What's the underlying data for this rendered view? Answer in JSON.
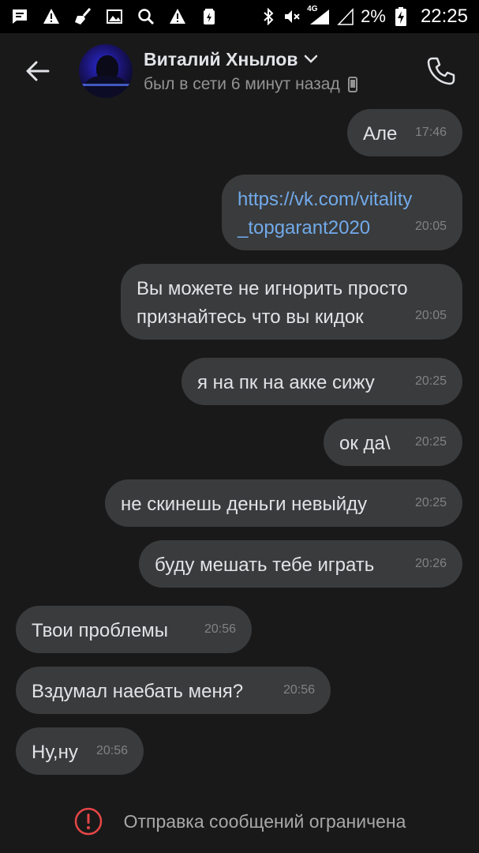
{
  "status_bar": {
    "battery_percent": "2%",
    "time": "22:25",
    "network": "4G",
    "left_icons": [
      "message-icon",
      "warning-icon",
      "broom-icon",
      "image-icon",
      "search-icon",
      "warning-icon",
      "battery-icon"
    ],
    "right_icons": [
      "bluetooth-icon",
      "mute-icon",
      "signal-icon",
      "battery-charging-icon"
    ]
  },
  "header": {
    "name": "Виталий Хнылов",
    "status": "был в сети 6 минут назад"
  },
  "messages": [
    {
      "dir": "out",
      "text": "Але",
      "time": "17:46"
    },
    {
      "dir": "out",
      "text": "https://vk.com/vitality_topgarant2020",
      "line1": "https://vk.com/vitality",
      "line2": "_topgarant2020",
      "time": "20:05"
    },
    {
      "dir": "out",
      "text": "Вы можете не игнорить просто признайтесь что вы кидок",
      "line1": "Вы можете не игнорить просто",
      "line2": "признайтесь что вы кидок",
      "time": "20:05"
    },
    {
      "dir": "out",
      "text": "я на пк на акке сижу",
      "time": "20:25"
    },
    {
      "dir": "out",
      "text": "ок да\\",
      "time": "20:25"
    },
    {
      "dir": "out",
      "text": "не скинешь деньги невыйду",
      "time": "20:25"
    },
    {
      "dir": "out",
      "text": "буду мешать тебе играть",
      "time": "20:26"
    },
    {
      "dir": "in",
      "text": "Твои проблемы",
      "time": "20:56"
    },
    {
      "dir": "in",
      "text": "Вздумал наебать меня?",
      "time": "20:56"
    },
    {
      "dir": "in",
      "text": "Ну,ну",
      "time": "20:56"
    }
  ],
  "footer": {
    "restriction_text": "Отправка сообщений ограничена"
  },
  "colors": {
    "background": "#19191a",
    "bubble": "#3a3b3c",
    "link": "#71aaeb",
    "error": "#e64646"
  }
}
